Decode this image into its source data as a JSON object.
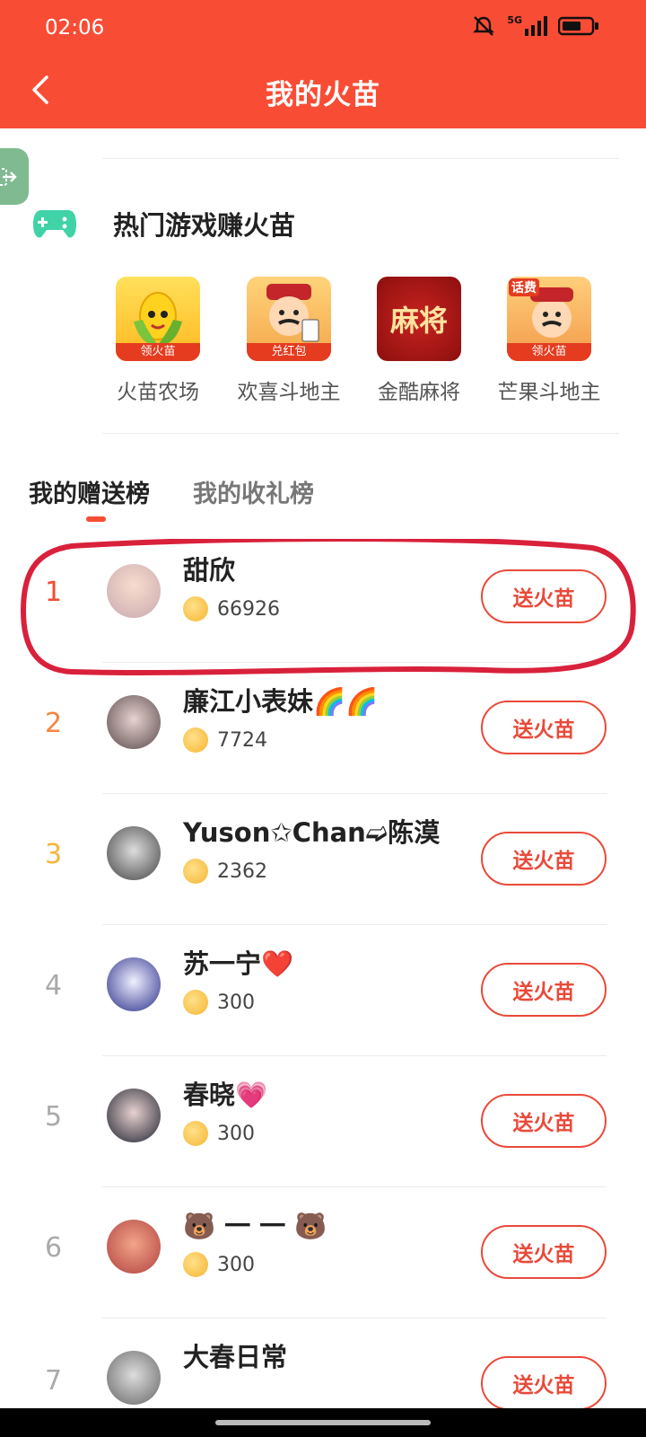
{
  "status": {
    "time": "02:06",
    "network": "5G"
  },
  "header": {
    "title": "我的火苗"
  },
  "games": {
    "title": "热门游戏赚火苗",
    "items": [
      {
        "name": "火苗农场",
        "badge": "领火苗"
      },
      {
        "name": "欢喜斗地主",
        "badge": "兑红包"
      },
      {
        "name": "金酷麻将",
        "badge": "",
        "icon_text": "麻将"
      },
      {
        "name": "芒果斗地主",
        "badge": "领火苗",
        "corner": "话费"
      }
    ]
  },
  "tabs": {
    "gift_sent": "我的赠送榜",
    "gift_received": "我的收礼榜"
  },
  "send_label": "送火苗",
  "ranking": [
    {
      "rank": "1",
      "name": "甜欣",
      "amount": "66926"
    },
    {
      "rank": "2",
      "name": "廉江小表妹🌈🌈",
      "amount": "7724"
    },
    {
      "rank": "3",
      "name": "Yuson✩Chan➫陈漠",
      "amount": "2362"
    },
    {
      "rank": "4",
      "name": "苏一宁❤️",
      "amount": "300"
    },
    {
      "rank": "5",
      "name": "春晓💗",
      "amount": "300"
    },
    {
      "rank": "6",
      "name": "🐻 一 一 🐻",
      "amount": "300"
    },
    {
      "rank": "7",
      "name": "大春日常",
      "amount": ""
    }
  ],
  "colors": {
    "primary": "#f94c35",
    "rank1": "#f24a34",
    "rank2": "#f58540",
    "rank3": "#f6b43a",
    "rank_other": "#aaaaaa"
  }
}
